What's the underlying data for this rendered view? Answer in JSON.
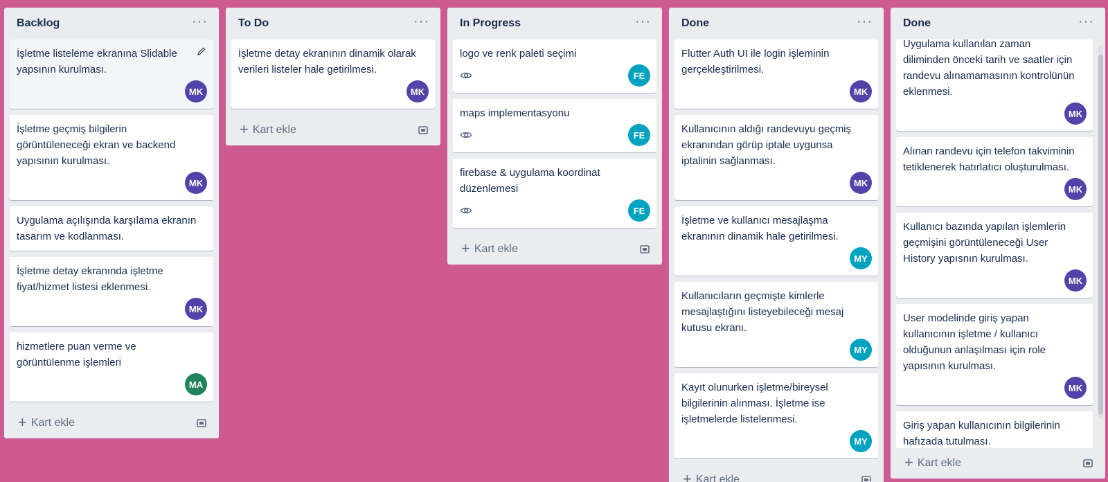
{
  "board": {
    "add_card_label": "Kart ekle",
    "menu_glyph": "···",
    "colors": {
      "background": "#cd5a91",
      "list": "#ebecf0",
      "MK": "#5243aa",
      "FE": "#00a3bf",
      "MY": "#00a3bf",
      "MA": "#1f845a"
    }
  },
  "lists": [
    {
      "title": "Backlog",
      "cards": [
        {
          "text": "İşletme listeleme ekranına Slidable yapsının kurulması.",
          "avatar": "MK"
        },
        {
          "text": "İşletme geçmiş bilgilerin görüntüleneceği ekran ve backend yapısının kurulması.",
          "avatar": "MK"
        },
        {
          "text": "Uygulama açılışında karşılama ekranın tasarım ve kodlanması."
        },
        {
          "text": "İşletme detay ekranında işletme fiyat/hizmet listesi eklenmesi.",
          "avatar": "MK"
        },
        {
          "text": "hizmetlere puan verme ve görüntülenme işlemleri",
          "avatar": "MA"
        }
      ]
    },
    {
      "title": "To Do",
      "cards": [
        {
          "text": "İşletme detay ekranının dinamik olarak verileri listeler hale getirilmesi.",
          "avatar": "MK"
        }
      ]
    },
    {
      "title": "In Progress",
      "cards": [
        {
          "text": "logo ve renk paleti seçimi",
          "avatar": "FE"
        },
        {
          "text": "maps implementasyonu",
          "avatar": "FE"
        },
        {
          "text": "firebase & uygulama koordinat düzenlemesi",
          "avatar": "FE"
        }
      ]
    },
    {
      "title": "Done",
      "cards": [
        {
          "text": "Flutter Auth UI ile login işleminin gerçekleştirilmesi.",
          "avatar": "MK"
        },
        {
          "text": "Kullanıcının aldığı randevuyu geçmiş ekranından görüp iptale uygunsa iptalinin sağlanması.",
          "avatar": "MK"
        },
        {
          "text": "İşletme ve kullanıcı mesajlaşma ekranının dinamik hale getirilmesi.",
          "avatar": "MY"
        },
        {
          "text": "Kullanıcıların geçmişte kimlerle mesajlaştığını listeyebileceği mesaj kutusu ekranı.",
          "avatar": "MY"
        },
        {
          "text": "Kayıt olunurken işletme/bireysel bilgilerinin alınması. İşletme ise işletmelerde listelenmesi.",
          "avatar": "MY"
        }
      ]
    },
    {
      "title": "Done",
      "cards": [
        {
          "text": "Uygulama kullanılan zaman diliminden önceki tarih ve saatler için randevu alınamamasının kontrolünün eklenmesi.",
          "avatar": "MK"
        },
        {
          "text": "Alınan randevu için telefon takviminin tetiklenerek hatırlatıcı oluşturulması.",
          "avatar": "MK"
        },
        {
          "text": "Kullanıcı bazında yapılan işlemlerin geçmişini görüntüleneceği User History yapısnın kurulması.",
          "avatar": "MK"
        },
        {
          "text": "User modelinde giriş yapan kullanıcının işletme / kullanıcı olduğunun anlaşılması için role yapısının kurulması.",
          "avatar": "MK"
        },
        {
          "text": "Giriş yapan kullanıcının bilgilerinin hafızada tutulması."
        }
      ]
    }
  ]
}
